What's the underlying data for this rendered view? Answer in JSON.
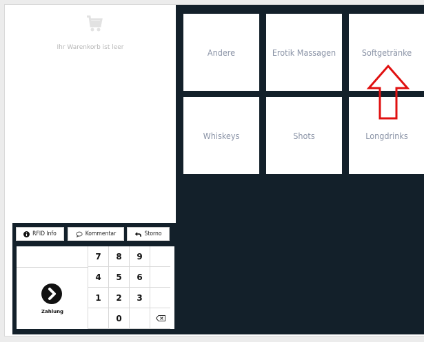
{
  "cart": {
    "empty_text": "Ihr Warenkorb ist leer",
    "icon": "shopping-cart-icon"
  },
  "toolbar": {
    "rfid_label": "RFID Info",
    "comment_label": "Kommentar",
    "storno_label": "Storno"
  },
  "keypad": {
    "keys": [
      "7",
      "8",
      "9",
      "4",
      "5",
      "6",
      "1",
      "2",
      "3",
      "0"
    ],
    "payment_label": "Zahlung"
  },
  "categories": [
    {
      "label": "Andere"
    },
    {
      "label": "Erotik Massagen"
    },
    {
      "label": "Softgetränke"
    },
    {
      "label": "Whiskeys"
    },
    {
      "label": "Shots"
    },
    {
      "label": "Longdrinks"
    }
  ],
  "colors": {
    "dark_panel": "#13202a",
    "tile_text": "#8a93a6",
    "annotation_arrow": "#e01010"
  }
}
